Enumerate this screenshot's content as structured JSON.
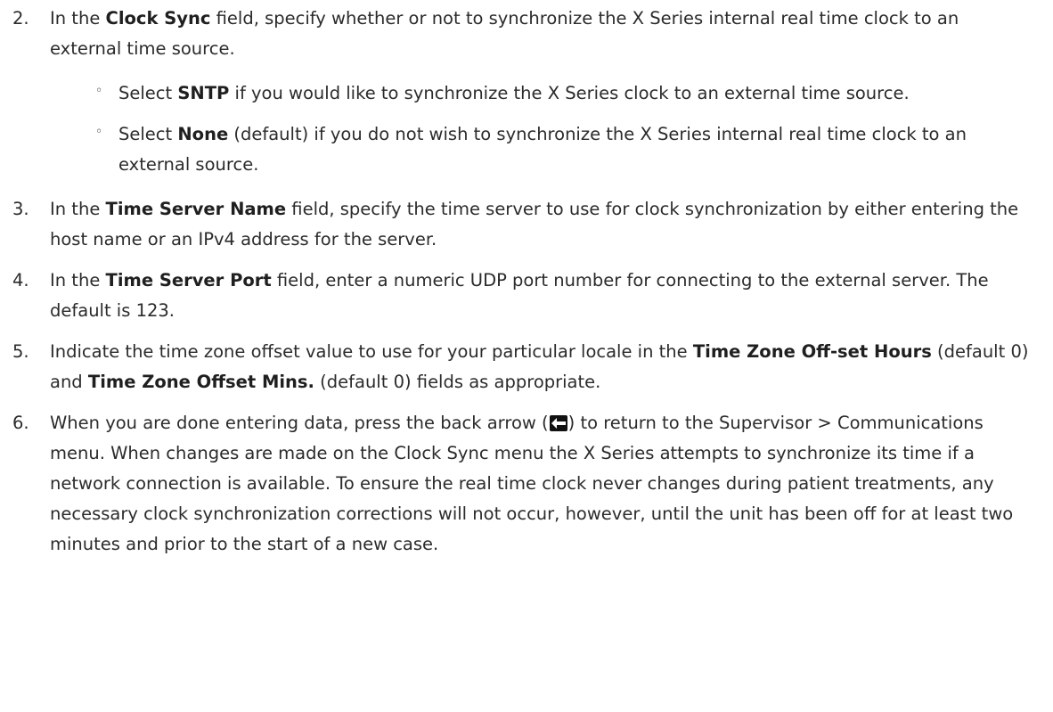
{
  "steps": [
    {
      "num": "2.",
      "parts": [
        "In the ",
        "Clock Sync",
        " field, specify whether or not to synchronize the X Series internal real time clock to an external time source."
      ],
      "subs": [
        {
          "parts": [
            "Select ",
            "SNTP",
            " if you would like to synchronize the X Series clock to an external time source."
          ]
        },
        {
          "parts": [
            "Select ",
            "None",
            " (default) if you do not wish to synchronize the X Series internal real time clock to an external source."
          ]
        }
      ]
    },
    {
      "num": "3.",
      "parts": [
        "In the ",
        "Time Server Name",
        " field, specify the time server to use for clock synchronization by either entering the host name or an IPv4 address for the server."
      ]
    },
    {
      "num": "4.",
      "parts": [
        "In the ",
        "Time Server Port",
        " field, enter a numeric UDP port number for connecting to the external server. The default is 123."
      ]
    },
    {
      "num": "5.",
      "parts": [
        "Indicate the time zone offset value to use for your particular locale in the ",
        "Time Zone Off-set Hours",
        " (default 0) and ",
        "Time Zone Offset Mins.",
        " (default 0) fields as appropriate."
      ]
    },
    {
      "num": "6.",
      "before_icon": "When you are done entering data, press the back arrow (",
      "after_icon": ") to return to the Supervisor > Communications menu. When changes are made on the Clock Sync menu the X Series attempts to synchronize its time if a network connection is available. To ensure the real time clock never changes during patient treatments, any necessary clock synchronization corrections will not occur, however, until the unit has been off for at least two minutes and prior to the start of a new case.",
      "icon": "back-arrow-icon"
    }
  ],
  "bullet_glyph": "◦"
}
